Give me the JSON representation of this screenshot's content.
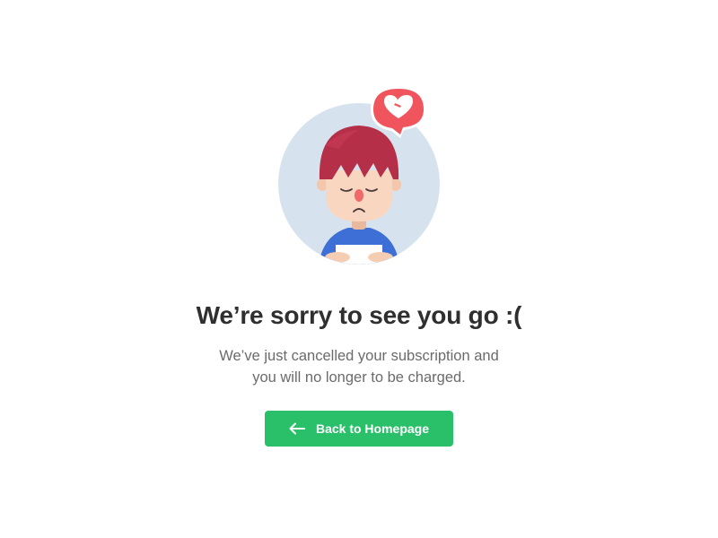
{
  "title": "We’re sorry to see you go :(",
  "subtitle": {
    "line1": "We’ve just cancelled your subscription and",
    "line2": "you will no longer to be charged."
  },
  "button": {
    "label": "Back to Homepage",
    "icon": "arrow-left-icon"
  },
  "illustration": {
    "avatar": "sad-boy-avatar",
    "badge_icon": "broken-heart-icon"
  },
  "colors": {
    "accent": "#2ac06a",
    "badge": "#f0545c",
    "circle_bg": "#d6e3ee",
    "hair": "#b52f48",
    "shirt": "#3d6fd6",
    "title": "#2f2f2f",
    "subtitle": "#6b6b6b"
  }
}
